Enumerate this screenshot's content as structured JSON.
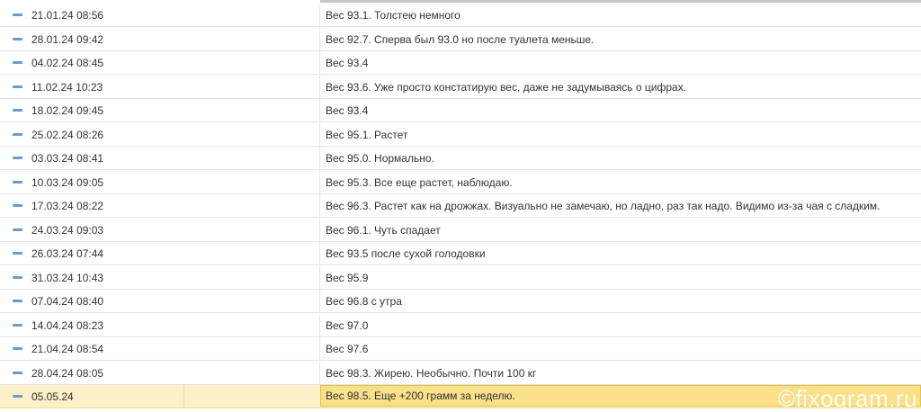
{
  "rows": [
    {
      "date": "21.01.24 08:56",
      "note": "Вес 93.1. Толстею немного"
    },
    {
      "date": "28.01.24 09:42",
      "note": "Вес 92.7. Сперва был 93.0 но после туалета меньше."
    },
    {
      "date": "04.02.24 08:45",
      "note": "Вес 93.4"
    },
    {
      "date": "11.02.24 10:23",
      "note": "Вес 93.6. Уже просто констатирую вес, даже не задумываясь о цифрах."
    },
    {
      "date": "18.02.24 09:45",
      "note": "Вес 93.4"
    },
    {
      "date": "25.02.24 08:26",
      "note": "Вес 95.1. Растет"
    },
    {
      "date": "03.03.24 08:41",
      "note": "Вес 95.0. Нормально."
    },
    {
      "date": "10.03.24 09:05",
      "note": "Вес 95.3. Все еще растет, наблюдаю."
    },
    {
      "date": "17.03.24 08:22",
      "note": "Вес 96.3. Растет как на дрожжах. Визуально не замечаю, но ладно, раз так надо. Видимо из-за чая с сладким."
    },
    {
      "date": "24.03.24 09:03",
      "note": "Вес 96.1. Чуть спадает"
    },
    {
      "date": "26.03.24 07:44",
      "note": "Вес 93.5 после сухой голодовки"
    },
    {
      "date": "31.03.24 10:43",
      "note": "Вес 95.9"
    },
    {
      "date": "07.04.24 08:40",
      "note": "Вес 96.8 с утра"
    },
    {
      "date": "14.04.24 08:23",
      "note": "Вес 97.0"
    },
    {
      "date": "21.04.24 08:54",
      "note": "Вес 97.6"
    },
    {
      "date": "28.04.24 08:05",
      "note": "Вес 98.3. Жирею. Необычно. Почти 100 кг"
    }
  ],
  "selected_row": {
    "date": "05.05.24",
    "note": "Вес 98.5. Еще +200 грамм за неделю."
  },
  "watermark": "©fixogram.ru",
  "colors": {
    "row_icon": "#6d9bc9",
    "selected_row_bg": "#fbf0c7",
    "selected_cell_bg": "#f9e089",
    "selected_cell_border": "#e8c246"
  },
  "icons": {
    "row_marker": "minus-icon"
  }
}
